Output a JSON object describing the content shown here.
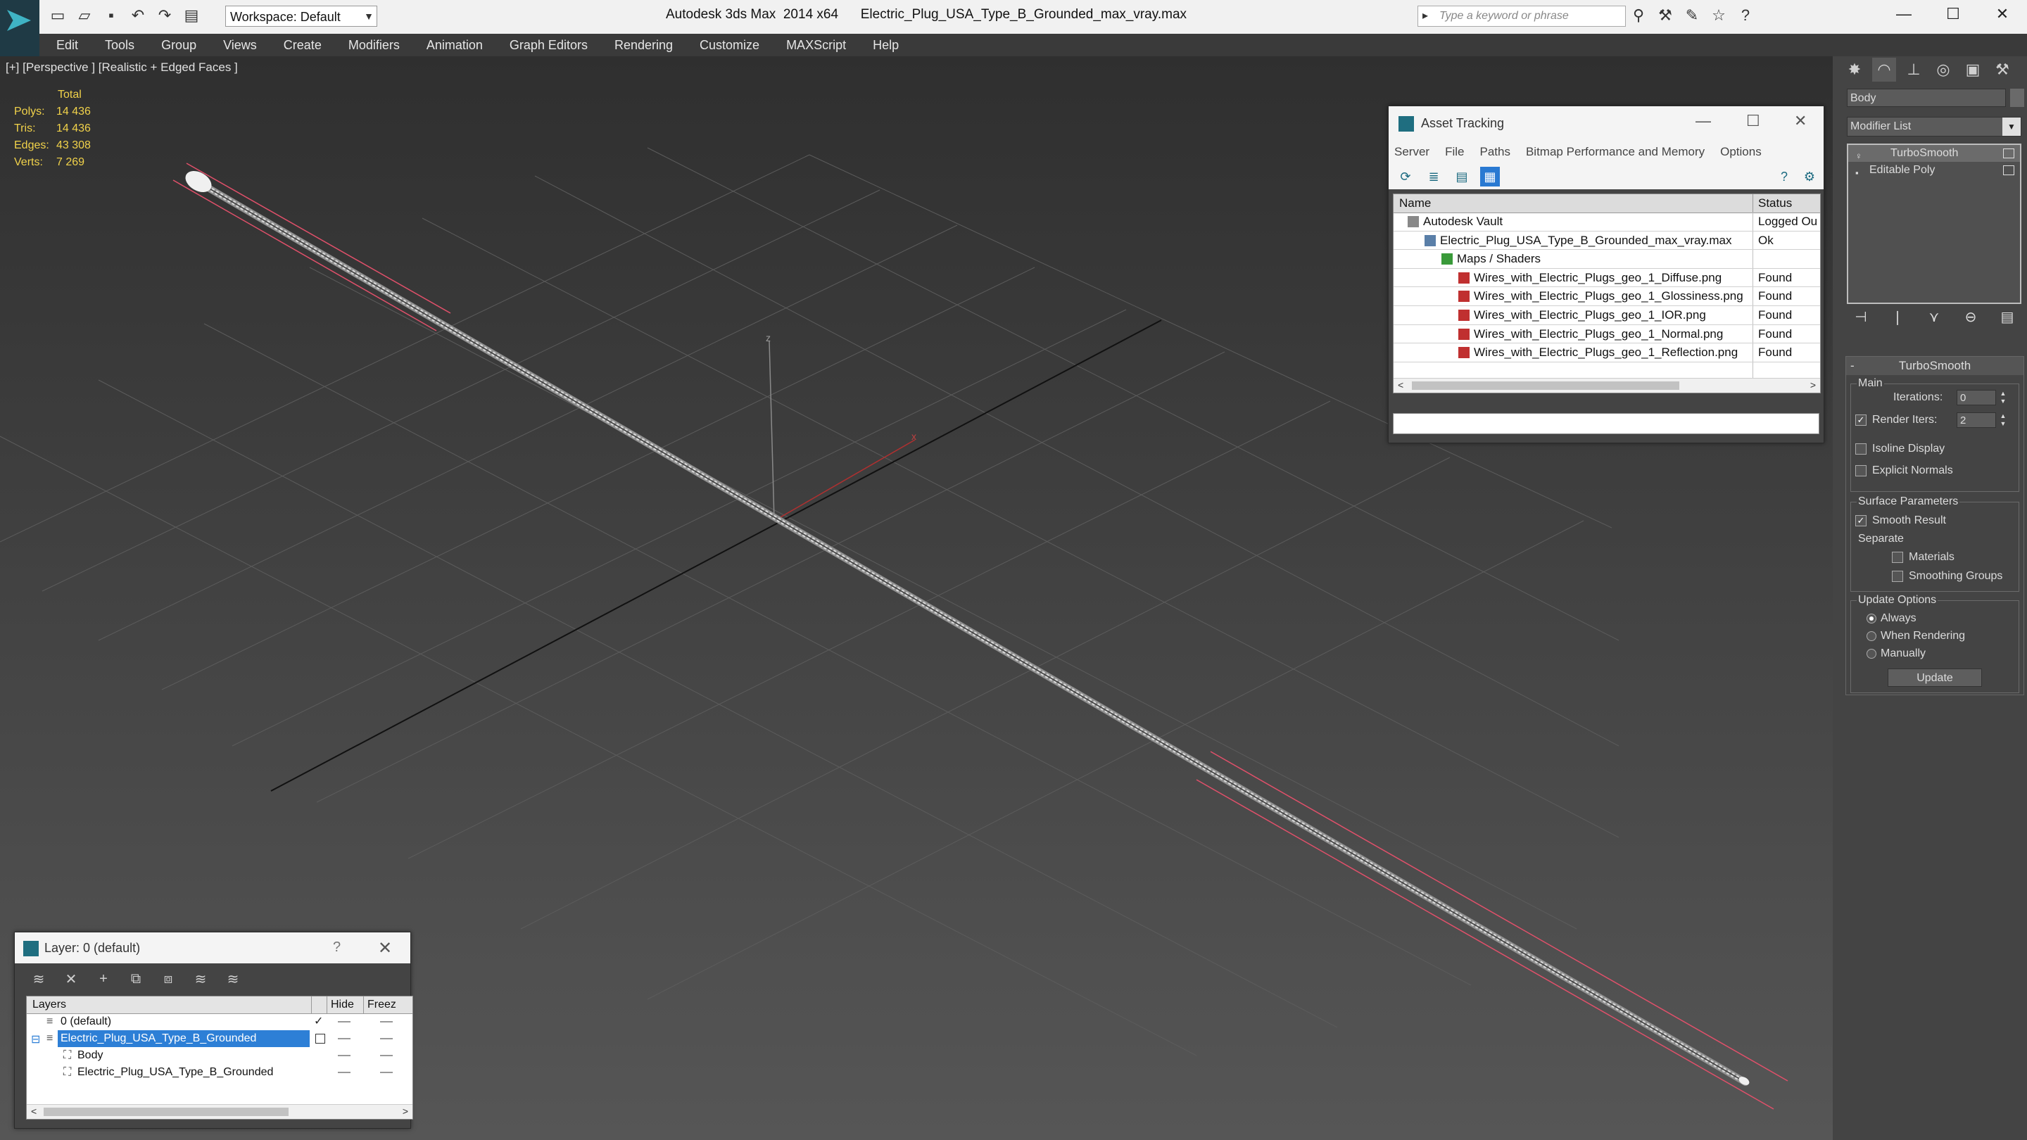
{
  "titlebar": {
    "workspace_label": "Workspace: Default",
    "app_title": "Autodesk 3ds Max  2014 x64",
    "file_title": "Electric_Plug_USA_Type_B_Grounded_max_vray.max",
    "search_placeholder": "Type a keyword or phrase"
  },
  "menu": [
    "Edit",
    "Tools",
    "Group",
    "Views",
    "Create",
    "Modifiers",
    "Animation",
    "Graph Editors",
    "Rendering",
    "Customize",
    "MAXScript",
    "Help"
  ],
  "viewport": {
    "label": "[+] [Perspective ] [Realistic + Edged Faces ]",
    "stats": {
      "header": "Total",
      "rows": [
        {
          "k": "Polys:",
          "v": "14 436"
        },
        {
          "k": "Tris:",
          "v": "14 436"
        },
        {
          "k": "Edges:",
          "v": "43 308"
        },
        {
          "k": "Verts:",
          "v": "7 269"
        }
      ]
    },
    "axis_z": "z",
    "axis_x": "x"
  },
  "command_panel": {
    "object_name": "Body",
    "modifier_list": "Modifier List",
    "stack": [
      "TurboSmooth",
      "Editable Poly"
    ],
    "rollout_title": "TurboSmooth",
    "main_group": "Main",
    "iterations_label": "Iterations:",
    "iterations_value": "0",
    "render_iters_label": "Render Iters:",
    "render_iters_value": "2",
    "render_iters_checked": true,
    "isoline_label": "Isoline Display",
    "explicit_normals_label": "Explicit Normals",
    "surface_group": "Surface Parameters",
    "smooth_result_label": "Smooth Result",
    "separate_label": "Separate",
    "materials_label": "Materials",
    "smoothing_groups_label": "Smoothing Groups",
    "update_group": "Update Options",
    "update_always": "Always",
    "update_when_rendering": "When Rendering",
    "update_manually": "Manually",
    "update_button": "Update"
  },
  "asset_tracking": {
    "title": "Asset Tracking",
    "menu": [
      "Server",
      "File",
      "Paths",
      "Bitmap Performance and Memory",
      "Options"
    ],
    "col_name": "Name",
    "col_status": "Status",
    "rows": [
      {
        "name": "Autodesk Vault",
        "status": "Logged Ou",
        "indent": 0,
        "icon": "vault-icon"
      },
      {
        "name": "Electric_Plug_USA_Type_B_Grounded_max_vray.max",
        "status": "Ok",
        "indent": 1,
        "icon": "max-file-icon"
      },
      {
        "name": "Maps / Shaders",
        "status": "",
        "indent": 2,
        "icon": "maps-folder-icon"
      },
      {
        "name": "Wires_with_Electric_Plugs_geo_1_Diffuse.png",
        "status": "Found",
        "indent": 3,
        "icon": "png-file-icon"
      },
      {
        "name": "Wires_with_Electric_Plugs_geo_1_Glossiness.png",
        "status": "Found",
        "indent": 3,
        "icon": "png-file-icon"
      },
      {
        "name": "Wires_with_Electric_Plugs_geo_1_IOR.png",
        "status": "Found",
        "indent": 3,
        "icon": "png-file-icon"
      },
      {
        "name": "Wires_with_Electric_Plugs_geo_1_Normal.png",
        "status": "Found",
        "indent": 3,
        "icon": "png-file-icon"
      },
      {
        "name": "Wires_with_Electric_Plugs_geo_1_Reflection.png",
        "status": "Found",
        "indent": 3,
        "icon": "png-file-icon"
      }
    ]
  },
  "layer_window": {
    "title": "Layer: 0 (default)",
    "help": "?",
    "col_layers": "Layers",
    "col_hide": "Hide",
    "col_freeze": "Freez",
    "rows": [
      {
        "name": "0 (default)",
        "indent": 0,
        "selected": false
      },
      {
        "name": "Electric_Plug_USA_Type_B_Grounded",
        "indent": 0,
        "selected": true
      },
      {
        "name": "Body",
        "indent": 1,
        "selected": false
      },
      {
        "name": "Electric_Plug_USA_Type_B_Grounded",
        "indent": 1,
        "selected": false
      }
    ]
  },
  "colors": {
    "viewport_top": "#2f2f2f",
    "viewport_bottom": "#565656",
    "stats_text": "#f1d24a",
    "selection_blue": "#2d7fd6",
    "selection_bracket": "#e0506a"
  }
}
